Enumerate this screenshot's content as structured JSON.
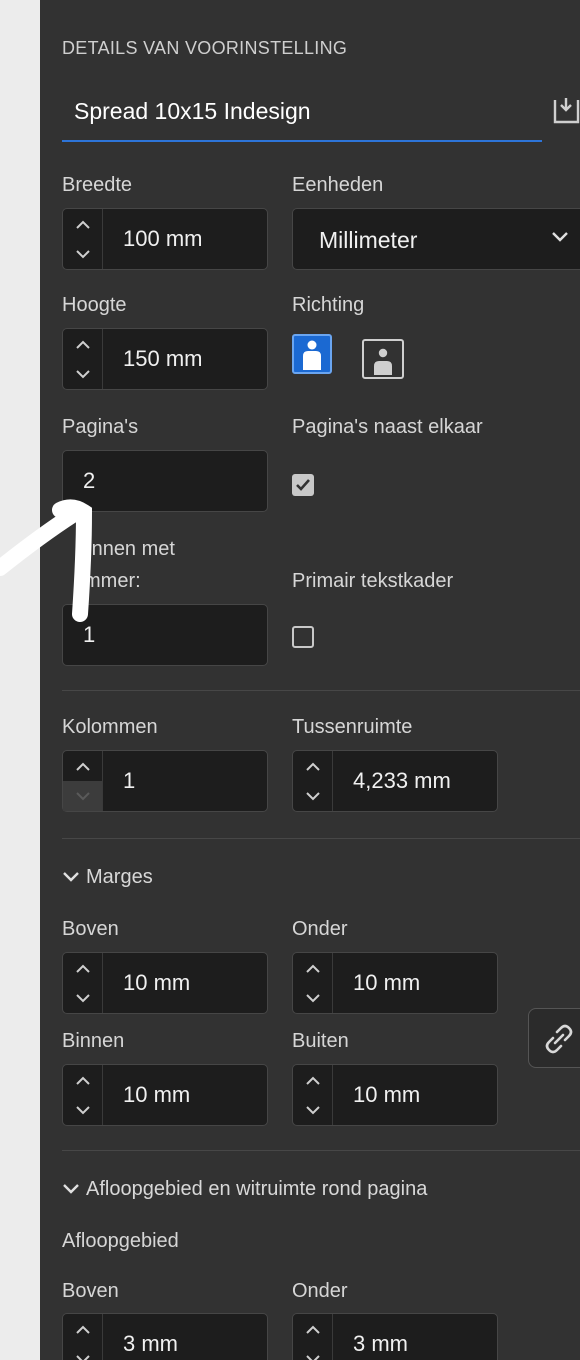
{
  "header": {
    "title": "DETAILS VAN VOORINSTELLING",
    "name_value": "Spread 10x15 Indesign"
  },
  "size": {
    "width_label": "Breedte",
    "width_value": "100 mm",
    "units_label": "Eenheden",
    "units_value": "Millimeter",
    "height_label": "Hoogte",
    "height_value": "150 mm",
    "orientation_label": "Richting"
  },
  "pages": {
    "pages_label": "Pagina's",
    "pages_value": "2",
    "facing_label": "Pagina's naast elkaar",
    "start_label_1": "ginnen met",
    "start_label_2": "mmer:",
    "start_value": "1",
    "primary_frame_label": "Primair tekstkader"
  },
  "columns": {
    "columns_label": "Kolommen",
    "columns_value": "1",
    "gutter_label": "Tussenruimte",
    "gutter_value": "4,233 mm"
  },
  "margins": {
    "section_label": "Marges",
    "top_label": "Boven",
    "top_value": "10 mm",
    "bottom_label": "Onder",
    "bottom_value": "10 mm",
    "inside_label": "Binnen",
    "inside_value": "10 mm",
    "outside_label": "Buiten",
    "outside_value": "10 mm"
  },
  "bleed": {
    "section_label": "Afloopgebied en witruimte rond pagina",
    "bleed_label": "Afloopgebied",
    "top_label": "Boven",
    "top_value": "3 mm",
    "bottom_label": "Onder",
    "bottom_value": "3 mm"
  },
  "colors": {
    "accent": "#2d74d8",
    "panel": "#323232",
    "field": "#1d1d1d",
    "page_bg": "#ececec"
  }
}
